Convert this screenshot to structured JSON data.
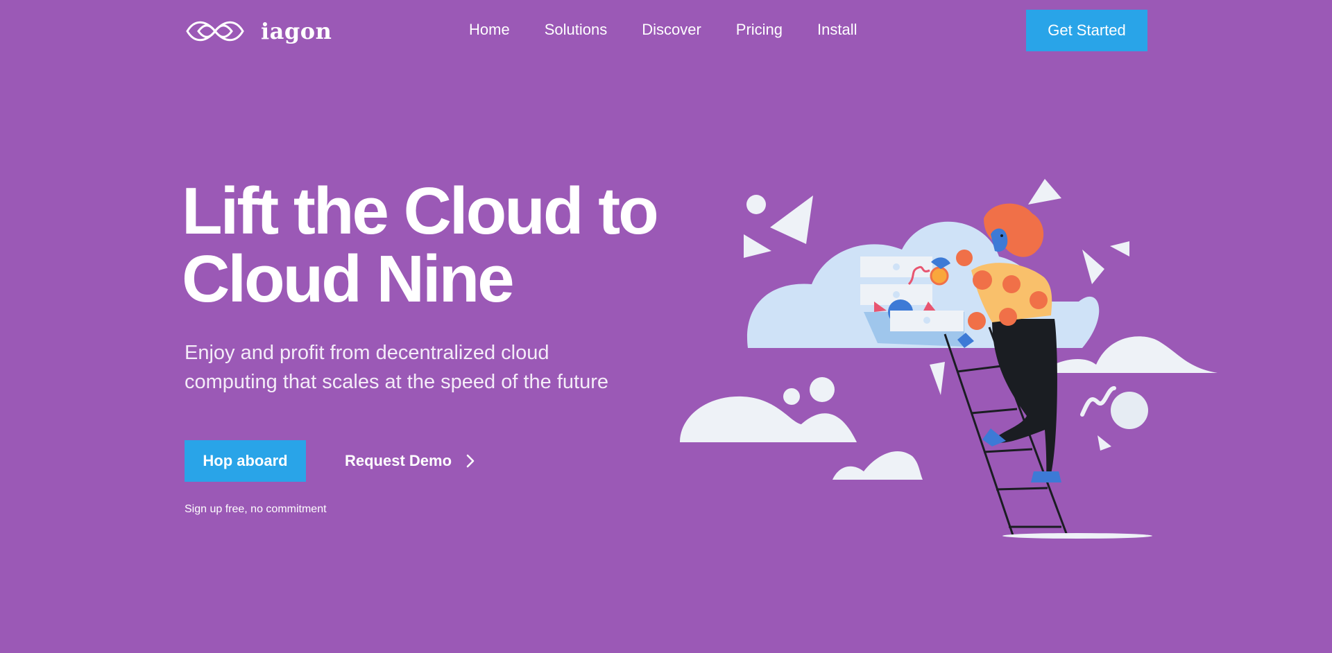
{
  "brand": {
    "name": "iagon",
    "logo_icon": "infinity-knot-logo"
  },
  "nav": {
    "links": [
      "Home",
      "Solutions",
      "Discover",
      "Pricing",
      "Install"
    ],
    "cta_label": "Get Started"
  },
  "hero": {
    "title_line1": "Lift the Cloud to",
    "title_line2": "Cloud Nine",
    "subtitle_line1": "Enjoy and profit from decentralized cloud",
    "subtitle_line2": "computing that scales at the speed of the future",
    "primary_button": "Hop aboard",
    "secondary_link": "Request Demo",
    "secondary_icon": "chevron-right-icon",
    "note": "Sign up free, no commitment"
  },
  "colors": {
    "background": "#9b59b6",
    "accent": "#29a4e8",
    "text": "#ffffff"
  }
}
